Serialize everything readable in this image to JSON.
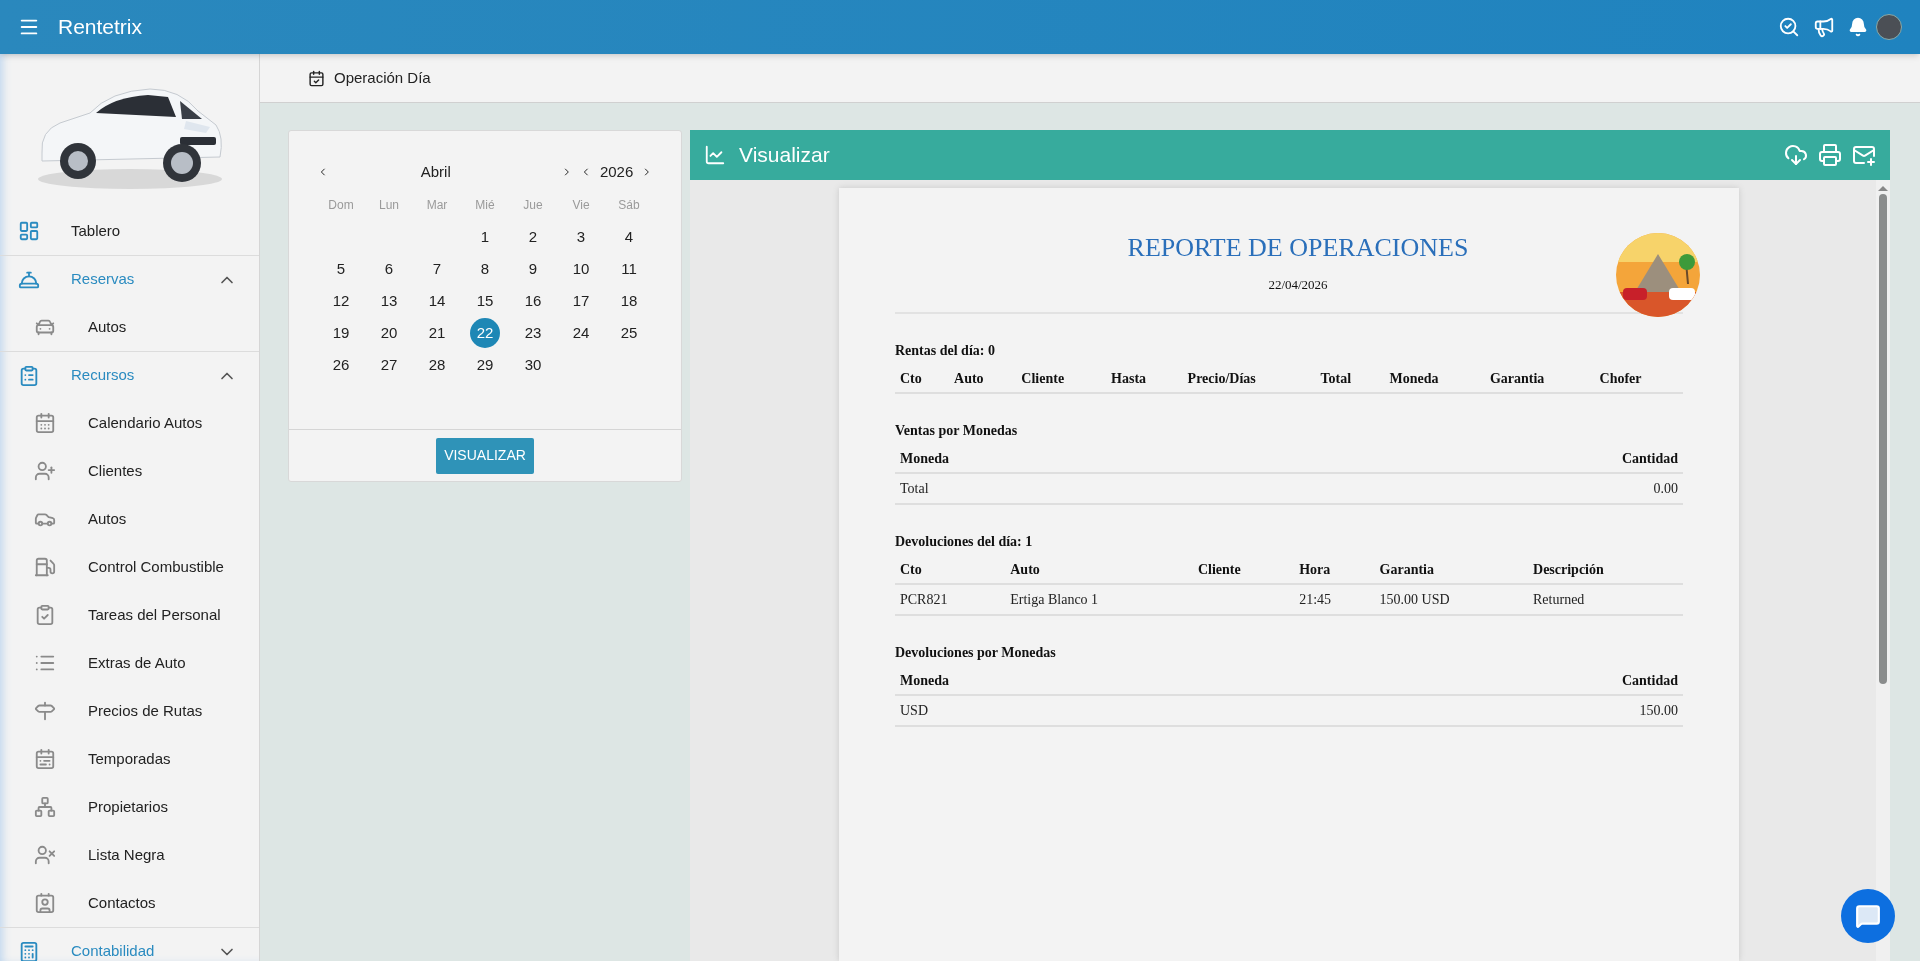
{
  "app": {
    "title": "Rentetrix"
  },
  "sidebar": {
    "items": [
      {
        "kind": "link",
        "label": "Tablero"
      },
      {
        "kind": "section",
        "label": "Reservas",
        "expanded": true,
        "children": [
          {
            "kind": "link",
            "label": "Autos"
          }
        ]
      },
      {
        "kind": "section",
        "label": "Recursos",
        "expanded": true,
        "children": [
          {
            "kind": "link",
            "label": "Calendario Autos"
          },
          {
            "kind": "link",
            "label": "Clientes"
          },
          {
            "kind": "link",
            "label": "Autos"
          },
          {
            "kind": "link",
            "label": "Control Combustible"
          },
          {
            "kind": "link",
            "label": "Tareas del Personal"
          },
          {
            "kind": "link",
            "label": "Extras de Auto"
          },
          {
            "kind": "link",
            "label": "Precios de Rutas"
          },
          {
            "kind": "link",
            "label": "Temporadas"
          },
          {
            "kind": "link",
            "label": "Propietarios"
          },
          {
            "kind": "link",
            "label": "Lista Negra"
          },
          {
            "kind": "link",
            "label": "Contactos"
          }
        ]
      },
      {
        "kind": "section",
        "label": "Contabilidad",
        "expanded": false
      }
    ]
  },
  "breadcrumb": "Operación Día",
  "calendar": {
    "month": "Abril",
    "year": "2026",
    "weekdays": [
      "Dom",
      "Lun",
      "Mar",
      "Mié",
      "Jue",
      "Vie",
      "Sáb"
    ],
    "weeks": [
      {
        "align_end": true,
        "days": [
          {
            "label": "1",
            "selected": false
          },
          {
            "label": "2",
            "selected": false
          },
          {
            "label": "3",
            "selected": false
          },
          {
            "label": "4",
            "selected": false
          }
        ]
      },
      {
        "days": [
          {
            "label": "5",
            "selected": false
          },
          {
            "label": "6",
            "selected": false
          },
          {
            "label": "7",
            "selected": false
          },
          {
            "label": "8",
            "selected": false
          },
          {
            "label": "9",
            "selected": false
          },
          {
            "label": "10",
            "selected": false
          },
          {
            "label": "11",
            "selected": false
          }
        ]
      },
      {
        "days": [
          {
            "label": "12",
            "selected": false
          },
          {
            "label": "13",
            "selected": false
          },
          {
            "label": "14",
            "selected": false
          },
          {
            "label": "15",
            "selected": false
          },
          {
            "label": "16",
            "selected": false
          },
          {
            "label": "17",
            "selected": false
          },
          {
            "label": "18",
            "selected": false
          }
        ]
      },
      {
        "days": [
          {
            "label": "19",
            "selected": false
          },
          {
            "label": "20",
            "selected": false
          },
          {
            "label": "21",
            "selected": false
          },
          {
            "label": "22",
            "selected": true
          },
          {
            "label": "23",
            "selected": false
          },
          {
            "label": "24",
            "selected": false
          },
          {
            "label": "25",
            "selected": false
          }
        ]
      },
      {
        "align_end": false,
        "days": [
          {
            "label": "26",
            "selected": false
          },
          {
            "label": "27",
            "selected": false
          },
          {
            "label": "28",
            "selected": false
          },
          {
            "label": "29",
            "selected": false
          },
          {
            "label": "30",
            "selected": false
          }
        ]
      }
    ],
    "button": "VISUALIZAR"
  },
  "viewer": {
    "title": "Visualizar",
    "report": {
      "title": "REPORTE DE OPERACIONES",
      "date": "22/04/2026",
      "sections": [
        {
          "heading": "Rentas del día: 0",
          "columns": [
            {
              "label": "Cto",
              "right_aligned": false
            },
            {
              "label": "Auto",
              "right_aligned": false
            },
            {
              "label": "Cliente",
              "right_aligned": false
            },
            {
              "label": "Hasta",
              "right_aligned": false
            },
            {
              "label": "Precio/Días",
              "right_aligned": false
            },
            {
              "label": "Total",
              "right_aligned": false
            },
            {
              "label": "Moneda",
              "right_aligned": false
            },
            {
              "label": "Garantia",
              "right_aligned": false
            },
            {
              "label": "Chofer",
              "right_aligned": false
            }
          ]
        },
        {
          "heading": "Ventas por Monedas",
          "columns": [
            {
              "label": "Moneda",
              "right_aligned": false
            },
            {
              "label": "Cantidad",
              "right_aligned": true
            }
          ],
          "rows": [
            [
              "Total",
              "0.00"
            ]
          ]
        },
        {
          "heading": "Devoluciones del día: 1",
          "columns": [
            {
              "label": "Cto",
              "right_aligned": false
            },
            {
              "label": "Auto",
              "right_aligned": false
            },
            {
              "label": "Cliente",
              "right_aligned": false
            },
            {
              "label": "Hora",
              "right_aligned": false
            },
            {
              "label": "Garantia",
              "right_aligned": false
            },
            {
              "label": "Descripción",
              "right_aligned": false
            }
          ],
          "rows": [
            [
              "PCR821",
              "Ertiga Blanco 1",
              null,
              "21:45",
              "150.00 USD",
              "Returned"
            ]
          ]
        },
        {
          "heading": "Devoluciones por Monedas",
          "columns": [
            {
              "label": "Moneda",
              "right_aligned": false
            },
            {
              "label": "Cantidad",
              "right_aligned": true
            }
          ],
          "rows": [
            [
              "USD",
              "150.00"
            ]
          ]
        }
      ]
    }
  }
}
